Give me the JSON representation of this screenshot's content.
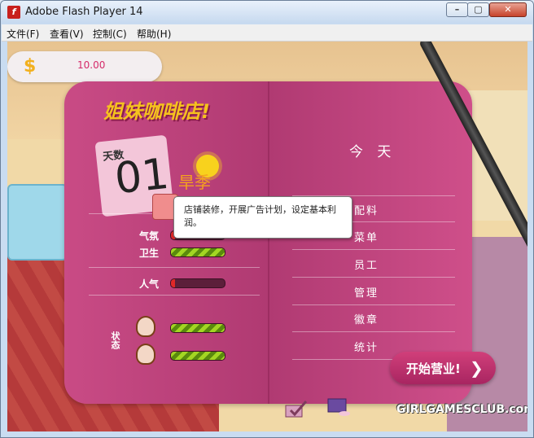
{
  "window": {
    "title": "Adobe Flash Player 14"
  },
  "menubar": {
    "items": [
      "文件(F)",
      "查看(V)",
      "控制(C)",
      "帮助(H)"
    ]
  },
  "hud": {
    "money": "10.00"
  },
  "book": {
    "title": "姐妹咖啡店!",
    "day_label": "天数",
    "day_number": "01",
    "season": "旱季",
    "stats": [
      {
        "label": "气氛",
        "level": 0.08
      },
      {
        "label": "卫生",
        "level": 1.0
      },
      {
        "label": "人气",
        "level": 0.08
      }
    ],
    "status_label": "状态",
    "staff": [
      {
        "level": 1.0
      },
      {
        "level": 1.0
      }
    ],
    "tooltip": "店铺装修，开展广告计划，设定基本利润。",
    "today_label": "今 天",
    "menu": [
      "配料",
      "菜单",
      "员工",
      "管理",
      "徽章",
      "统计"
    ],
    "start_button": "开始营业!"
  },
  "logo": "GIRLGAMESCLUB.com",
  "colors": {
    "book": "#c94b85",
    "accent": "#f5c21e",
    "bar_good": "#a3d623",
    "bar_bad": "#e02828"
  }
}
